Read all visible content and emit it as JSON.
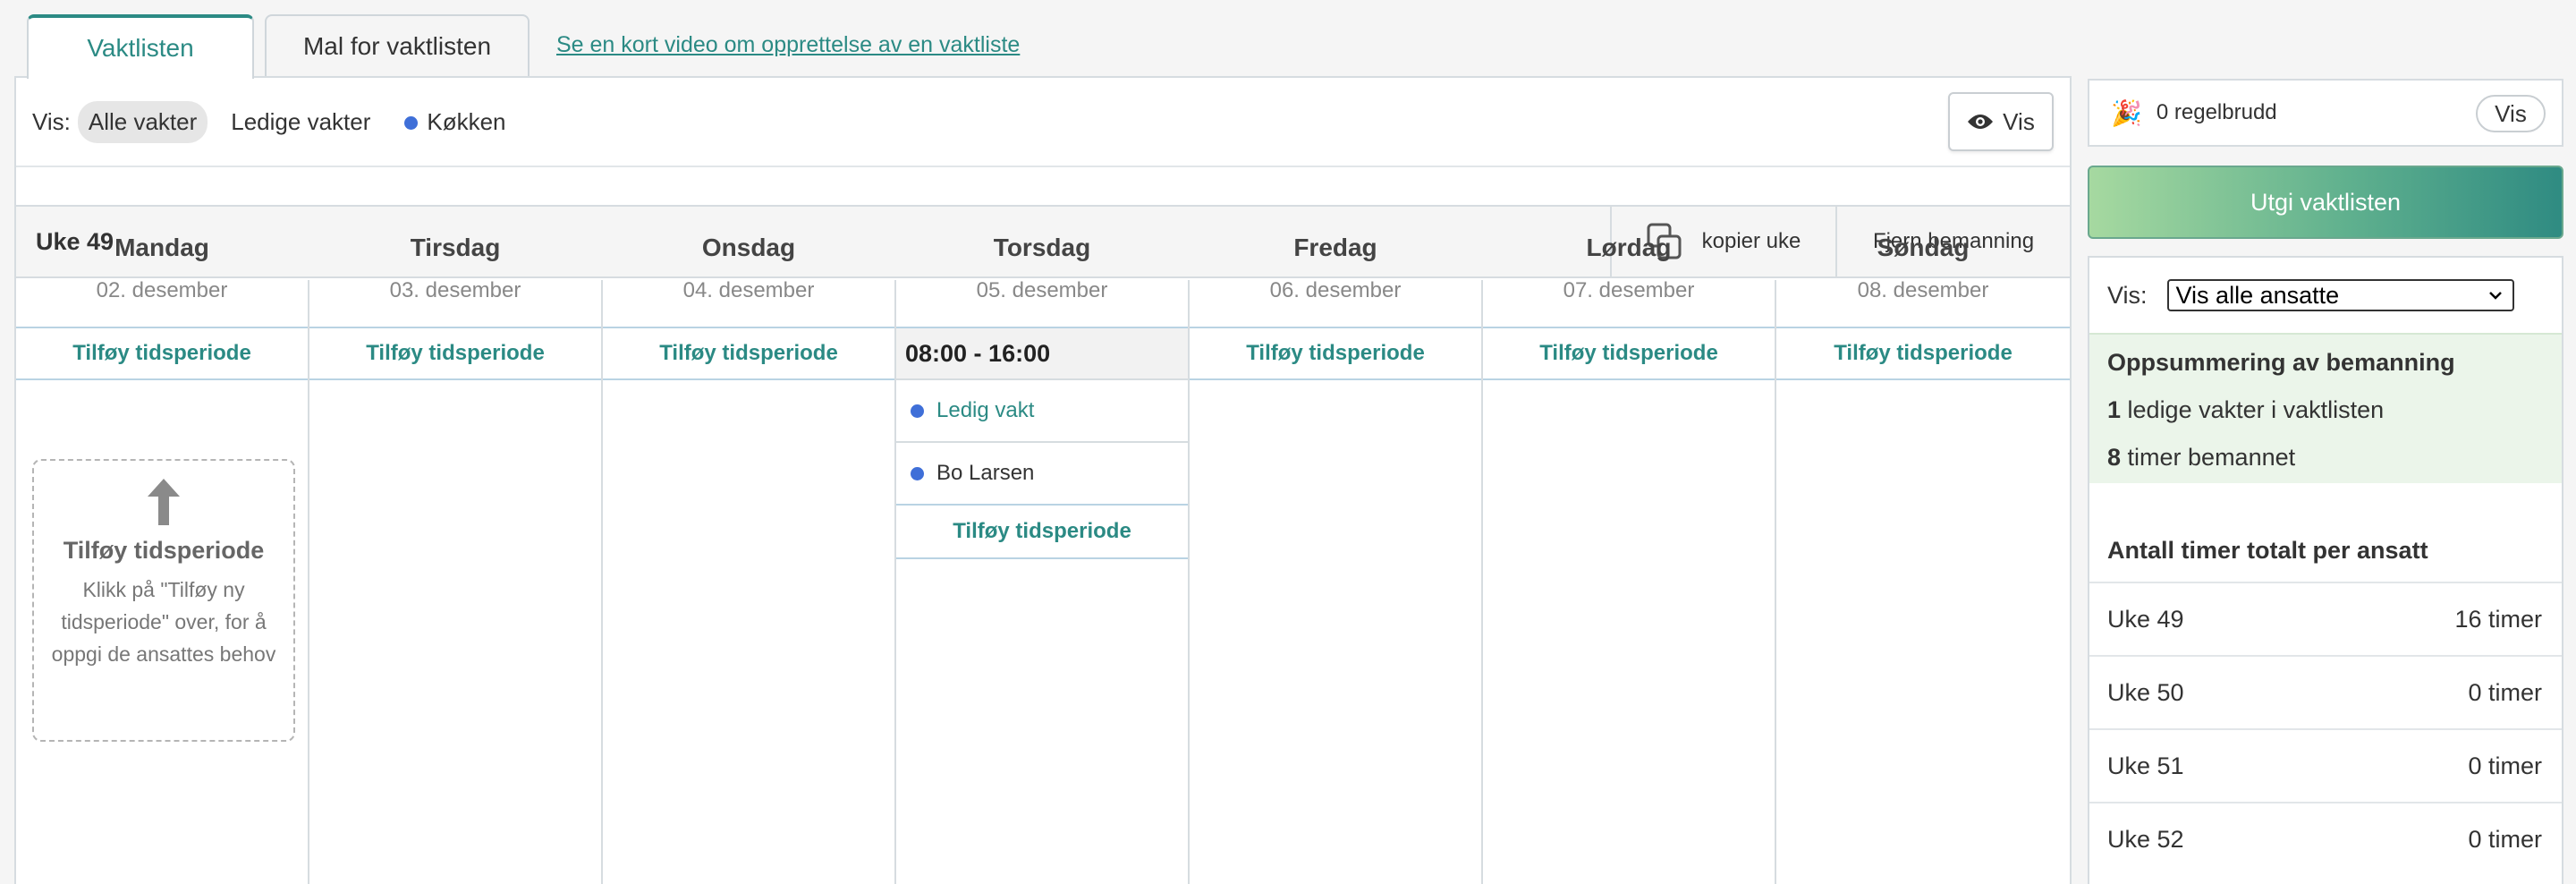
{
  "tabs": [
    {
      "label": "Vaktlisten",
      "active": true
    },
    {
      "label": "Mal for vaktlisten",
      "active": false
    }
  ],
  "video_link": "Se en kort video om opprettelse av en vaktliste",
  "filter": {
    "label": "Vis:",
    "chips": [
      "Alle vakter",
      "Ledige vakter",
      "Køkken"
    ],
    "vis_button": "Vis"
  },
  "week": {
    "title": "Uke 49",
    "copy_label": "kopier uke",
    "remove_label": "Fjern bemanning"
  },
  "days": [
    {
      "name": "Mandag",
      "date": "02. desember"
    },
    {
      "name": "Tirsdag",
      "date": "03. desember"
    },
    {
      "name": "Onsdag",
      "date": "04. desember"
    },
    {
      "name": "Torsdag",
      "date": "05. desember"
    },
    {
      "name": "Fredag",
      "date": "06. desember"
    },
    {
      "name": "Lørdag",
      "date": "07. desember"
    },
    {
      "name": "Søndag",
      "date": "08. desember"
    }
  ],
  "add_period_label": "Tilføy tidsperiode",
  "thursday": {
    "period": "08:00 - 16:00",
    "shifts": [
      "Ledig vakt",
      "Bo Larsen"
    ]
  },
  "placeholder": {
    "title": "Tilføy tidsperiode",
    "text": "Klikk på \"Tilføy ny tidsperiode\" over, for å oppgi de ansattes behov"
  },
  "rules": {
    "text": "0 regelbrudd",
    "button": "Vis"
  },
  "publish_label": "Utgi vaktlisten",
  "sidebar": {
    "vis_label": "Vis:",
    "select_value": "Vis alle ansatte",
    "summary_title": "Oppsummering av bemanning",
    "summary_lines": [
      {
        "num": "1",
        "text": " ledige vakter i vaktlisten"
      },
      {
        "num": "8",
        "text": " timer bemannet"
      }
    ],
    "hours_title": "Antall timer totalt per ansatt",
    "weeks": [
      {
        "week": "Uke 49",
        "hours": "16 timer"
      },
      {
        "week": "Uke 50",
        "hours": "0 timer"
      },
      {
        "week": "Uke 51",
        "hours": "0 timer"
      },
      {
        "week": "Uke 52",
        "hours": "0 timer"
      }
    ]
  },
  "colors": {
    "accent": "#2b8a84",
    "dot": "#3f6fd8",
    "summary_bg": "#ebf5ea"
  }
}
